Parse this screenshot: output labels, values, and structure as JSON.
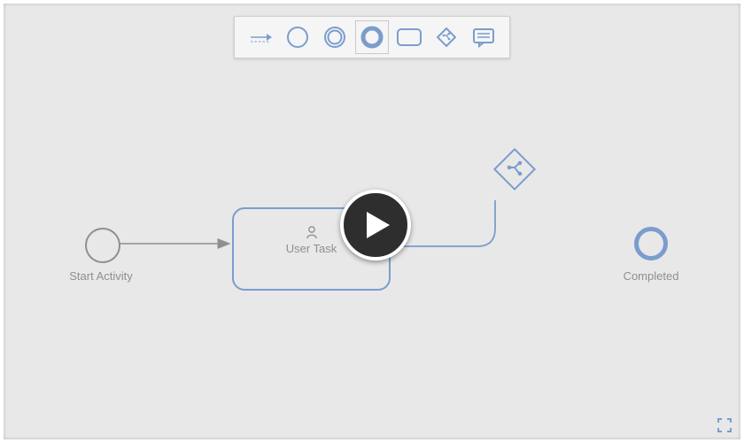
{
  "palette": {
    "items": [
      {
        "name": "sequence-flow",
        "selected": false
      },
      {
        "name": "start-event",
        "selected": false
      },
      {
        "name": "intermediate-event",
        "selected": false
      },
      {
        "name": "end-event",
        "selected": true
      },
      {
        "name": "task",
        "selected": false
      },
      {
        "name": "gateway",
        "selected": false
      },
      {
        "name": "annotation",
        "selected": false
      }
    ]
  },
  "nodes": {
    "start": {
      "label": "Start Activity"
    },
    "task": {
      "label": "User Task",
      "icon": "user-icon"
    },
    "gateway": {
      "icon": "branch-icon"
    },
    "end": {
      "label": "Completed"
    }
  },
  "colors": {
    "accent": "#7b9dcd",
    "muted": "#8f8f8f",
    "dark": "#2e2e2e"
  }
}
